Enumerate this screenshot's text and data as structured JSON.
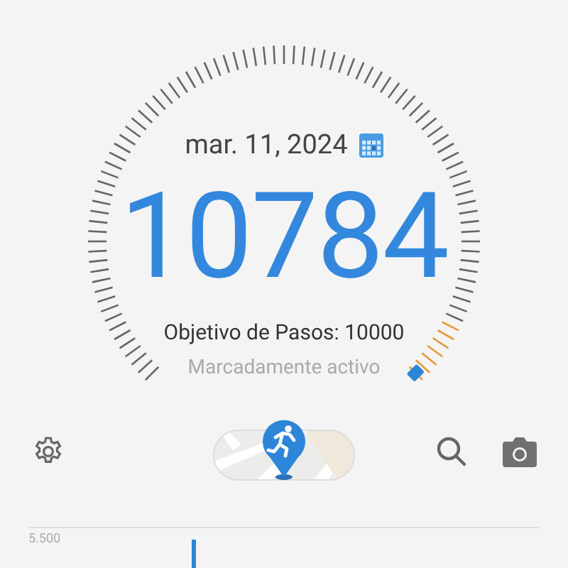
{
  "header": {
    "date": "mar. 11, 2024"
  },
  "steps": {
    "count": "10784",
    "goal": "Objetivo de Pasos: 10000",
    "status": "Marcadamente activo"
  },
  "chart": {
    "axis_label": "5.500"
  }
}
